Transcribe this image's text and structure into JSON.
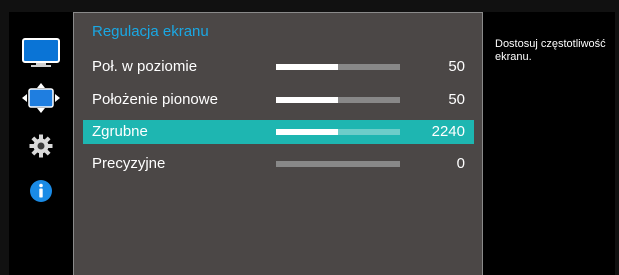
{
  "menu": {
    "title": "Regulacja ekranu",
    "items": [
      {
        "label": "Poł. w poziomie",
        "value": "50",
        "fill_fraction": 0.5,
        "selected": false
      },
      {
        "label": "Położenie pionowe",
        "value": "50",
        "fill_fraction": 0.5,
        "selected": false
      },
      {
        "label": "Zgrubne",
        "value": "2240",
        "fill_fraction": 0.5,
        "selected": true
      },
      {
        "label": "Precyzyjne",
        "value": "0",
        "fill_fraction": 0.0,
        "selected": false
      }
    ]
  },
  "help": {
    "text": "Dostosuj częstotliwość ekranu."
  },
  "side_icons": [
    {
      "name": "picture-icon",
      "active": false
    },
    {
      "name": "screen-adjustment-icon",
      "active": true
    },
    {
      "name": "gear-icon",
      "active": false
    },
    {
      "name": "info-icon",
      "active": false
    }
  ],
  "colors": {
    "accent": "#1aa8e4",
    "selected_row": "#1eb6b1",
    "panel_bg": "#4b4746"
  }
}
